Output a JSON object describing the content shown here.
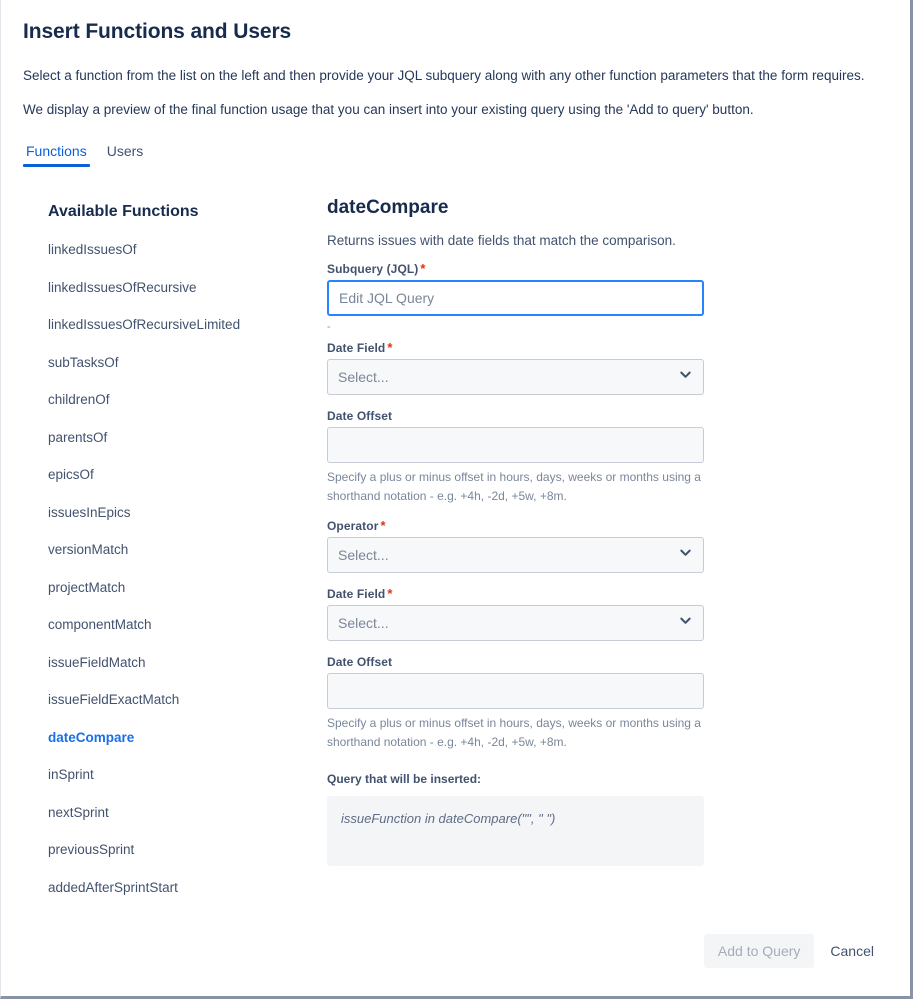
{
  "dialog": {
    "title": "Insert Functions and Users",
    "intro_line1": "Select a function from the list on the left and then provide your JQL subquery along with any other function parameters that the form requires.",
    "intro_line2": "We display a preview of the final function usage that you can insert into your existing query using the 'Add to query' button."
  },
  "tabs": [
    {
      "label": "Functions",
      "active": true
    },
    {
      "label": "Users",
      "active": false
    }
  ],
  "sidebar": {
    "heading": "Available Functions",
    "items": [
      {
        "label": "linkedIssuesOf",
        "selected": false
      },
      {
        "label": "linkedIssuesOfRecursive",
        "selected": false
      },
      {
        "label": "linkedIssuesOfRecursiveLimited",
        "selected": false
      },
      {
        "label": "subTasksOf",
        "selected": false
      },
      {
        "label": "childrenOf",
        "selected": false
      },
      {
        "label": "parentsOf",
        "selected": false
      },
      {
        "label": "epicsOf",
        "selected": false
      },
      {
        "label": "issuesInEpics",
        "selected": false
      },
      {
        "label": "versionMatch",
        "selected": false
      },
      {
        "label": "projectMatch",
        "selected": false
      },
      {
        "label": "componentMatch",
        "selected": false
      },
      {
        "label": "issueFieldMatch",
        "selected": false
      },
      {
        "label": "issueFieldExactMatch",
        "selected": false
      },
      {
        "label": "dateCompare",
        "selected": true
      },
      {
        "label": "inSprint",
        "selected": false
      },
      {
        "label": "nextSprint",
        "selected": false
      },
      {
        "label": "previousSprint",
        "selected": false
      },
      {
        "label": "addedAfterSprintStart",
        "selected": false
      }
    ]
  },
  "detail": {
    "title": "dateCompare",
    "description": "Returns issues with date fields that match the comparison.",
    "subquery": {
      "label": "Subquery (JQL)",
      "required_marker": "*",
      "value": "",
      "placeholder": "Edit JQL Query",
      "sub_text": "-"
    },
    "date_field_1": {
      "label": "Date Field",
      "required_marker": "*",
      "value": "Select..."
    },
    "date_offset_1": {
      "label": "Date Offset",
      "value": "",
      "placeholder": "",
      "help": "Specify a plus or minus offset in hours, days, weeks or months using a shorthand notation - e.g. +4h, -2d, +5w, +8m."
    },
    "operator": {
      "label": "Operator",
      "required_marker": "*",
      "value": "Select..."
    },
    "date_field_2": {
      "label": "Date Field",
      "required_marker": "*",
      "value": "Select..."
    },
    "date_offset_2": {
      "label": "Date Offset",
      "value": "",
      "placeholder": "",
      "help": "Specify a plus or minus offset in hours, days, weeks or months using a shorthand notation - e.g. +4h, -2d, +5w, +8m."
    },
    "preview": {
      "label": "Query that will be inserted:",
      "code": "issueFunction in dateCompare(\"\", \" \")"
    }
  },
  "footer": {
    "add_to_query_label": "Add to Query",
    "cancel_label": "Cancel"
  },
  "colors": {
    "accent_blue": "#0B5FD9",
    "selected_item": "#1a6fe8",
    "required_red": "#DE350B",
    "focus_border": "#2684FF",
    "text_primary": "#172B4D",
    "text_secondary": "#42526E",
    "text_muted": "#7A869A",
    "field_bg": "#F7F8F9",
    "preview_bg": "#F4F5F7"
  }
}
